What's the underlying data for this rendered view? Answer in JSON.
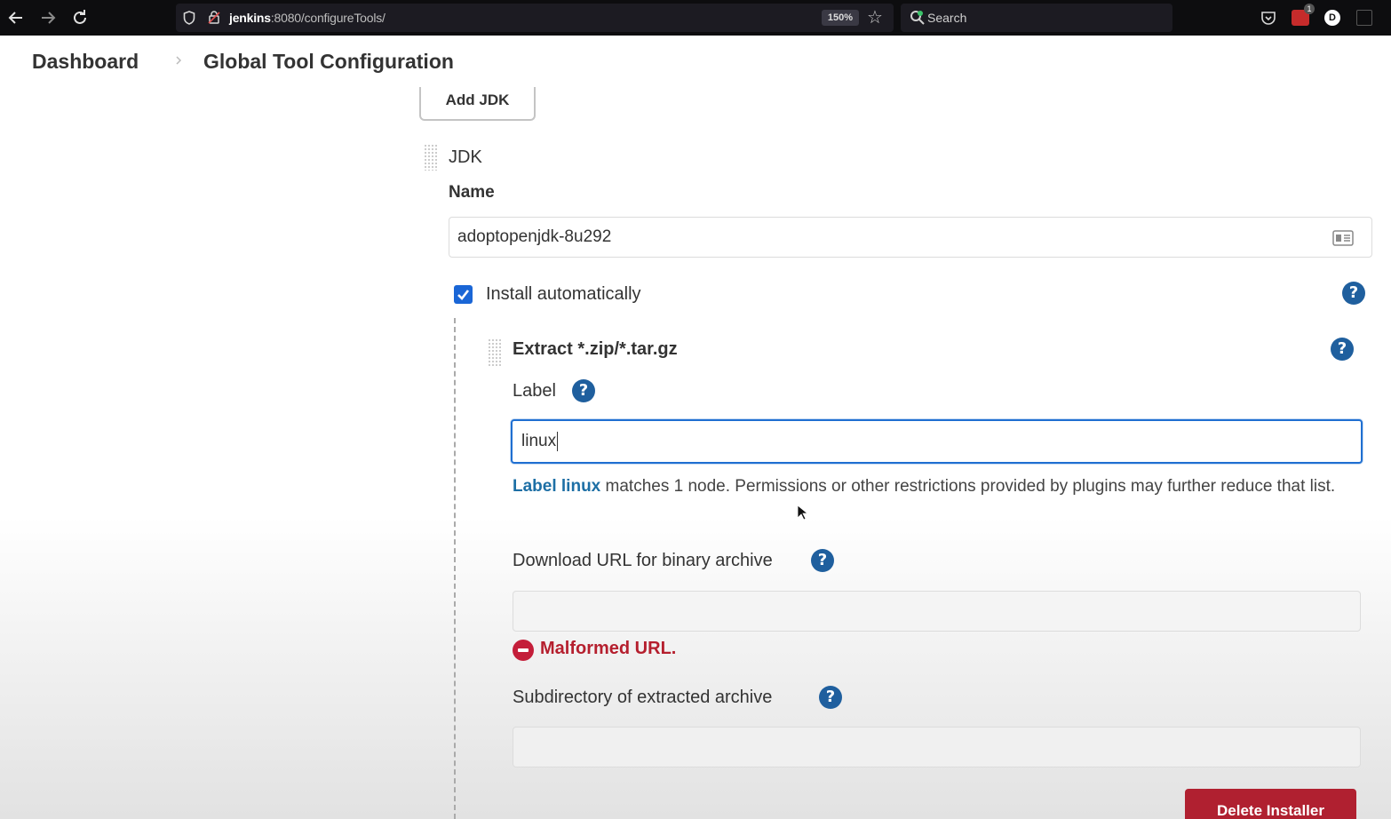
{
  "browser": {
    "url_host": "jenkins",
    "url_rest": ":8080/configureTools/",
    "zoom": "150%",
    "search_placeholder": "Search",
    "extension_badge": "1",
    "profile_initial": "D"
  },
  "breadcrumb": {
    "dashboard": "Dashboard",
    "current": "Global Tool Configuration"
  },
  "jdk_section": {
    "add_button": "Add JDK",
    "title": "JDK",
    "name_label": "Name",
    "name_value": "adoptopenjdk-8u292",
    "install_auto_label": "Install automatically",
    "install_auto_checked": true
  },
  "installer": {
    "title": "Extract *.zip/*.tar.gz",
    "label_label": "Label",
    "label_value": "linux",
    "label_link": "Label linux",
    "label_message": " matches 1 node. Permissions or other restrictions provided by plugins may further reduce that list.",
    "download_url_label": "Download URL for binary archive",
    "download_url_value": "",
    "error_message": "Malformed URL.",
    "subdir_label": "Subdirectory of extracted archive",
    "subdir_value": "",
    "delete_button": "Delete Installer"
  },
  "help_icon_glyph": "?",
  "colors": {
    "accent_blue": "#1f6fd1",
    "help_blue": "#1f5f9e",
    "error_red": "#b51f2e",
    "delete_red": "#b02030",
    "link_blue": "#1d6fa5"
  }
}
